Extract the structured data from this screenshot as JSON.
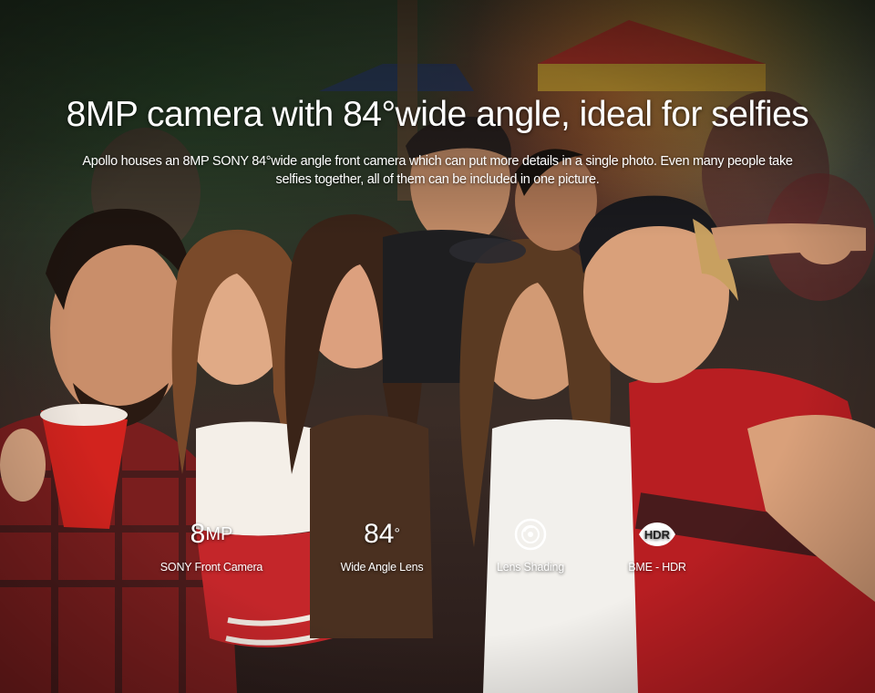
{
  "headline": "8MP camera with 84°wide angle, ideal for selfies",
  "subtext_line1": "Apollo houses an 8MP SONY 84°wide angle front camera which can put more details in a single photo. Even many people take",
  "subtext_line2": "selfies together, all of them can be included in one picture.",
  "features": [
    {
      "value": "8",
      "unit": "MP",
      "label": "SONY Front Camera",
      "icon": "8mp-text-icon"
    },
    {
      "value": "84",
      "unit": "°",
      "label": "Wide Angle Lens",
      "icon": "84-degree-text-icon"
    },
    {
      "label": "Lens Shading",
      "icon": "lens-shading-icon"
    },
    {
      "label": "BME - HDR",
      "icon": "hdr-icon",
      "icon_text": "HDR"
    }
  ]
}
